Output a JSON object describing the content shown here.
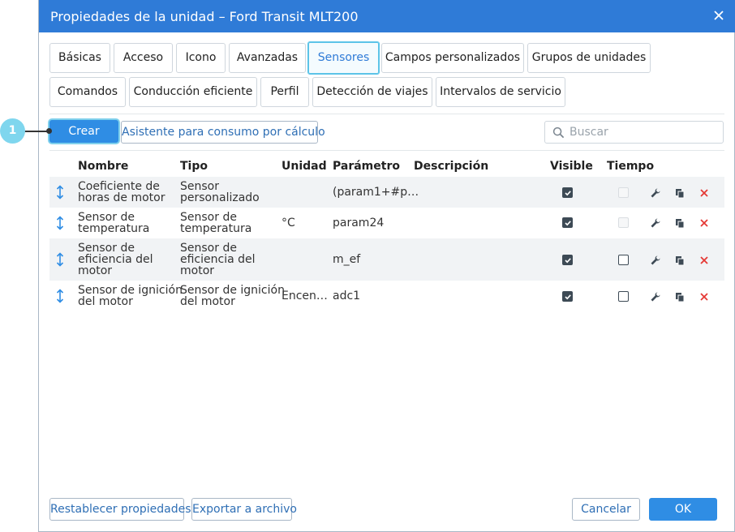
{
  "dialog": {
    "title": "Propiedades de la unidad – Ford Transit MLT200"
  },
  "tabs": [
    {
      "label": "Básicas"
    },
    {
      "label": "Acceso"
    },
    {
      "label": "Icono"
    },
    {
      "label": "Avanzadas"
    },
    {
      "label": "Sensores",
      "active": true
    },
    {
      "label": "Campos personalizados"
    },
    {
      "label": "Grupos de unidades"
    },
    {
      "label": "Comandos"
    },
    {
      "label": "Conducción eficiente"
    },
    {
      "label": "Perfil"
    },
    {
      "label": "Detección de viajes"
    },
    {
      "label": "Intervalos de servicio"
    }
  ],
  "toolbar": {
    "create_label": "Crear",
    "wizard_label": "Asistente para consumo por cálculo",
    "search_placeholder": "Buscar"
  },
  "callout": {
    "number": "1"
  },
  "table": {
    "headers": {
      "name": "Nombre",
      "type": "Tipo",
      "unit": "Unidad",
      "param": "Parámetro",
      "desc": "Descripción",
      "visible": "Visible",
      "time": "Tiempo"
    },
    "rows": [
      {
        "name": [
          "Coeficiente de",
          "horas de motor"
        ],
        "type": [
          "Sensor",
          "personalizado"
        ],
        "unit": "",
        "param": "(param1+#p…",
        "visible": true,
        "time": "disabled"
      },
      {
        "name": [
          "Sensor de",
          "temperatura"
        ],
        "type": [
          "Sensor de",
          "temperatura"
        ],
        "unit": "°C",
        "param": "param24",
        "visible": true,
        "time": "disabled"
      },
      {
        "name": [
          "Sensor de",
          "eficiencia del",
          "motor"
        ],
        "type": [
          "Sensor de",
          "eficiencia del",
          "motor"
        ],
        "unit": "",
        "param": "m_ef",
        "visible": true,
        "time": "unchecked"
      },
      {
        "name": [
          "Sensor de ignición",
          "del motor"
        ],
        "type": [
          "Sensor de ignición",
          "del motor"
        ],
        "unit": "Encen…",
        "param": "adc1",
        "visible": true,
        "time": "unchecked"
      }
    ]
  },
  "footer": {
    "reset_label": "Restablecer propiedades",
    "export_label": "Exportar a archivo",
    "cancel_label": "Cancelar",
    "ok_label": "OK"
  },
  "colors": {
    "title_bar": "#2f7bd7",
    "primary_button": "#2f8de4",
    "active_tab_border": "#5cc4e8",
    "callout": "#7fd6ee",
    "delete_icon": "#e53935"
  }
}
